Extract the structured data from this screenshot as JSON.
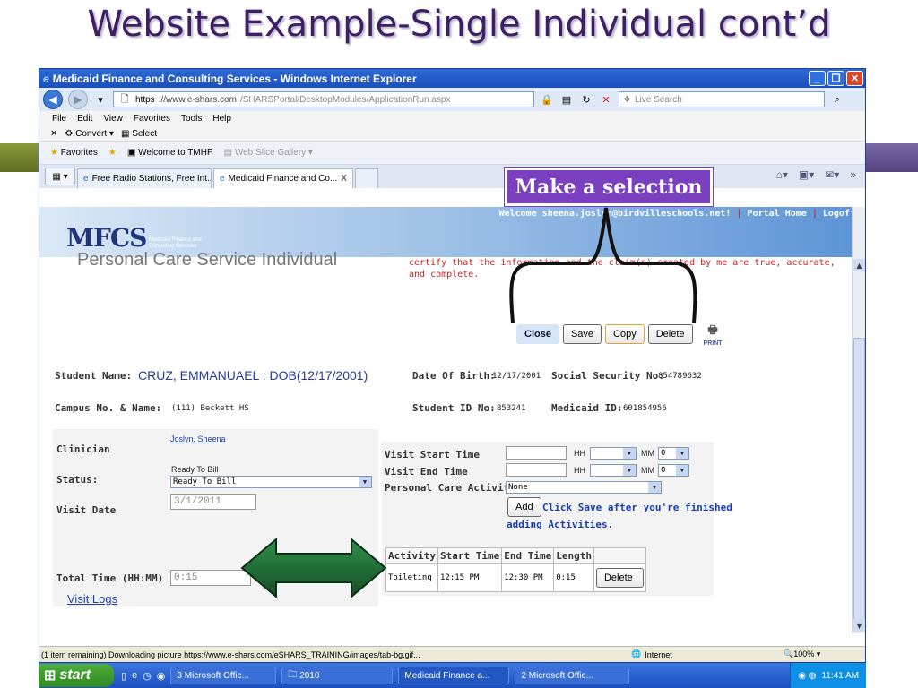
{
  "slide": {
    "title": "Website Example-Single Individual cont’d",
    "callout": "Make a selection"
  },
  "browser": {
    "window_title": "Medicaid Finance and Consulting Services - Windows Internet Explorer",
    "url_scheme": "https",
    "url_host": "://www.e-shars.com",
    "url_path": "/SHARSPortal/DesktopModules/ApplicationRun.aspx",
    "search_placeholder": "Live Search",
    "menu": [
      "File",
      "Edit",
      "View",
      "Favorites",
      "Tools",
      "Help"
    ],
    "convert_label": "Convert",
    "select_label": "Select",
    "favorites_label": "Favorites",
    "fav_links": [
      "Welcome to TMHP",
      "Web Slice Gallery"
    ],
    "tabs": [
      "Free Radio Stations, Free Int...",
      "Medicaid Finance and Co..."
    ],
    "tab_close": "X",
    "status_text": "(1 item remaining) Downloading picture https://www.e-shars.com/eSHARS_TRAINING/images/tab-bg.gif...",
    "zone": "Internet",
    "zoom": "100%"
  },
  "header": {
    "logo": "MFCS",
    "logo_sub_1": "Medicaid Finance and",
    "logo_sub_2": "Consulting Services",
    "welcome": "Welcome sheena.joslyn@birdvilleschools.net!",
    "sep": "|",
    "portal_home": "Portal Home",
    "logoff": "Logoff",
    "page_heading": "Personal Care Service Individual"
  },
  "form": {
    "certify": "certify that the information and the claim(s) created by me are true, accurate, and complete.",
    "buttons": {
      "close": "Close",
      "save": "Save",
      "copy": "Copy",
      "delete": "Delete",
      "print": "PRINT"
    },
    "student_name_label": "Student Name:",
    "student_name_value": "CRUZ, EMMANUAEL  : DOB(12/17/2001)",
    "dob_label": "Date Of Birth:",
    "dob_value": "12/17/2001",
    "ssn_label": "Social Security No:",
    "ssn_value": "854789632",
    "campus_label": "Campus No. & Name:",
    "campus_value": "(111) Beckett HS",
    "student_id_label": "Student ID No:",
    "student_id_value": "853241",
    "medicaid_id_label": "Medicaid ID:",
    "medicaid_id_value": "601854956",
    "clinician_label": "Clinician",
    "clinician_value": "Joslyn, Sheena",
    "status_label": "Status:",
    "status_text": "Ready To Bill",
    "status_select": "Ready To Bill",
    "visit_date_label": "Visit Date",
    "visit_date_value": "3/1/2011",
    "total_time_label": "Total Time (HH:MM)",
    "total_time_value": "0:15",
    "visit_logs": "Visit Logs",
    "visit_start_label": "Visit Start Time",
    "visit_end_label": "Visit End Time",
    "activity_label": "Personal Care Activity",
    "hh": "HH",
    "mm": "MM",
    "mm_value": "0",
    "activity_select": "None",
    "add_button": "Add",
    "add_hint_1": "Click Save after you're finished",
    "add_hint_2": "adding Activities."
  },
  "activities_table": {
    "headers": [
      "Activity",
      "Start Time",
      "End Time",
      "Length",
      ""
    ],
    "rows": [
      {
        "activity": "Toileting",
        "start": "12:15 PM",
        "end": "12:30 PM",
        "length": "0:15",
        "action": "Delete"
      }
    ]
  },
  "taskbar": {
    "start": "start",
    "tasks": [
      "3 Microsoft Offic...",
      "2010",
      "Medicaid Finance a...",
      "2 Microsoft Offic..."
    ],
    "clock": "11:41 AM"
  },
  "colors": {
    "title": "#3d1f66",
    "callout": "#7a40c0",
    "arrow": "#1f6b34",
    "certify": "#cc2222"
  }
}
